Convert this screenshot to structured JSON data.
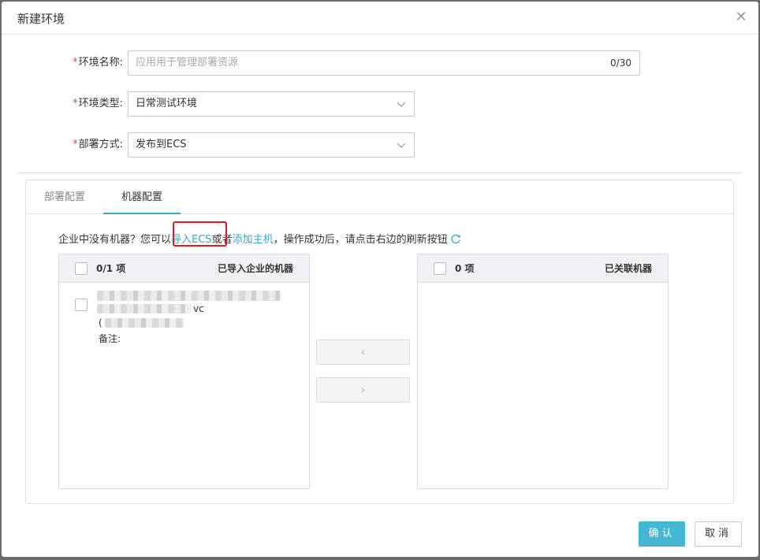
{
  "dialog": {
    "title": "新建环境",
    "close_icon": "close-icon"
  },
  "form": {
    "name": {
      "label": "环境名称:",
      "placeholder": "应用用于管理部署资源",
      "counter": "0/30"
    },
    "type": {
      "label": "环境类型:",
      "value": "日常测试环境"
    },
    "deploy": {
      "label": "部署方式:",
      "value": "发布到ECS"
    },
    "required_mark": "*"
  },
  "tabs": [
    {
      "label": "部署配置",
      "active": false
    },
    {
      "label": "机器配置",
      "active": true
    }
  ],
  "hint": {
    "prefix": "企业中没有机器？您可以",
    "link_import": "导入ECS",
    "middle": "或者",
    "link_add": "添加主机",
    "suffix": "，操作成功后，请点击右边的刷新按钮",
    "refresh_icon": "refresh-icon"
  },
  "transfer": {
    "left": {
      "count": "0/1 项",
      "title": "已导入企业的机器",
      "item": {
        "line2_tail": "vc",
        "line3_head": "(",
        "remark_label": "备注:"
      }
    },
    "right": {
      "count": "0 项",
      "title": "已关联机器"
    },
    "move_left_label": "‹",
    "move_right_label": "›"
  },
  "footer": {
    "confirm_label": "确认",
    "cancel_label": "取消"
  },
  "colors": {
    "accent": "#45b7d5",
    "link": "#3aa7c9",
    "required": "#e84a4a",
    "highlight": "#d81e1e"
  }
}
